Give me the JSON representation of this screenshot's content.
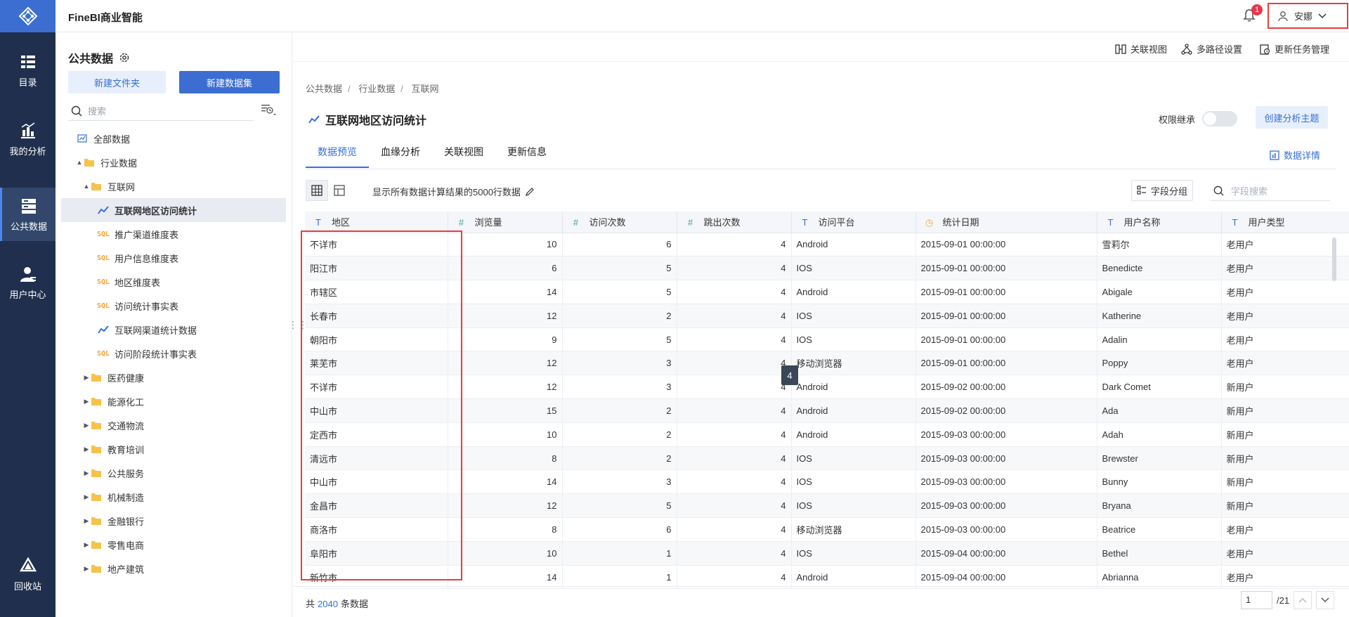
{
  "app": {
    "brand": "FineBI商业智能"
  },
  "nav": {
    "items": [
      {
        "label": "目录",
        "icon": "catalog-icon"
      },
      {
        "label": "我的分析",
        "icon": "analysis-icon"
      },
      {
        "label": "公共数据",
        "icon": "public-data-icon"
      },
      {
        "label": "用户中心",
        "icon": "user-center-icon"
      },
      {
        "label": "回收站",
        "icon": "recycle-icon"
      }
    ]
  },
  "header": {
    "notification_count": "1",
    "user_name": "安娜"
  },
  "sidebar": {
    "title": "公共数据",
    "new_folder": "新建文件夹",
    "new_dataset": "新建数据集",
    "search_placeholder": "搜索",
    "tree": [
      {
        "label": "全部数据",
        "type": "all",
        "level": 0,
        "caret": ""
      },
      {
        "label": "行业数据",
        "type": "folder",
        "level": 1,
        "caret": "▲"
      },
      {
        "label": "互联网",
        "type": "folder",
        "level": 2,
        "caret": "▲"
      },
      {
        "label": "互联网地区访问统计",
        "type": "analysis",
        "level": 3,
        "caret": "",
        "selected": true
      },
      {
        "label": "推广渠道维度表",
        "type": "sql",
        "level": 3,
        "caret": ""
      },
      {
        "label": "用户信息维度表",
        "type": "sql",
        "level": 3,
        "caret": ""
      },
      {
        "label": "地区维度表",
        "type": "sql",
        "level": 3,
        "caret": ""
      },
      {
        "label": "访问统计事实表",
        "type": "sql",
        "level": 3,
        "caret": ""
      },
      {
        "label": "互联网渠道统计数据",
        "type": "analysis",
        "level": 3,
        "caret": ""
      },
      {
        "label": "访问阶段统计事实表",
        "type": "sql",
        "level": 3,
        "caret": ""
      },
      {
        "label": "医药健康",
        "type": "folder",
        "level": 2,
        "caret": "▶"
      },
      {
        "label": "能源化工",
        "type": "folder",
        "level": 2,
        "caret": "▶"
      },
      {
        "label": "交通物流",
        "type": "folder",
        "level": 2,
        "caret": "▶"
      },
      {
        "label": "教育培训",
        "type": "folder",
        "level": 2,
        "caret": "▶"
      },
      {
        "label": "公共服务",
        "type": "folder",
        "level": 2,
        "caret": "▶"
      },
      {
        "label": "机械制造",
        "type": "folder",
        "level": 2,
        "caret": "▶"
      },
      {
        "label": "金融银行",
        "type": "folder",
        "level": 2,
        "caret": "▶"
      },
      {
        "label": "零售电商",
        "type": "folder",
        "level": 2,
        "caret": "▶"
      },
      {
        "label": "地产建筑",
        "type": "folder",
        "level": 2,
        "caret": "▶"
      }
    ]
  },
  "toolbar": {
    "relation_view": "关联视图",
    "multipath": "多路径设置",
    "update_tasks": "更新任务管理"
  },
  "breadcrumb": [
    "公共数据",
    "行业数据",
    "互联网"
  ],
  "page": {
    "title": "互联网地区访问统计",
    "permission_label": "权限继承",
    "create_theme": "创建分析主题",
    "data_detail": "数据详情"
  },
  "tabs": [
    "数据预览",
    "血缘分析",
    "关联视图",
    "更新信息"
  ],
  "preview": {
    "row_info": "显示所有数据计算结果的5000行数据",
    "group_btn": "字段分组",
    "field_search_placeholder": "字段搜索",
    "tooltip": "4"
  },
  "table": {
    "columns": [
      {
        "label": "地区",
        "type": "text"
      },
      {
        "label": "浏览量",
        "type": "number"
      },
      {
        "label": "访问次数",
        "type": "number"
      },
      {
        "label": "跳出次数",
        "type": "number"
      },
      {
        "label": "访问平台",
        "type": "text"
      },
      {
        "label": "统计日期",
        "type": "date"
      },
      {
        "label": "用户名称",
        "type": "text"
      },
      {
        "label": "用户类型",
        "type": "text"
      }
    ],
    "rows": [
      [
        "不详市",
        "10",
        "6",
        "4",
        "Android",
        "2015-09-01 00:00:00",
        "雪莉尔",
        "老用户"
      ],
      [
        "阳江市",
        "6",
        "5",
        "4",
        "IOS",
        "2015-09-01 00:00:00",
        "Benedicte",
        "老用户"
      ],
      [
        "市辖区",
        "14",
        "5",
        "4",
        "Android",
        "2015-09-01 00:00:00",
        "Abigale",
        "老用户"
      ],
      [
        "长春市",
        "12",
        "2",
        "4",
        "IOS",
        "2015-09-01 00:00:00",
        "Katherine",
        "老用户"
      ],
      [
        "朝阳市",
        "9",
        "5",
        "4",
        "IOS",
        "2015-09-01 00:00:00",
        "Adalin",
        "老用户"
      ],
      [
        "莱芜市",
        "12",
        "3",
        "4",
        "移动浏览器",
        "2015-09-01 00:00:00",
        "Poppy",
        "老用户"
      ],
      [
        "不详市",
        "12",
        "3",
        "4",
        "Android",
        "2015-09-02 00:00:00",
        "Dark Comet",
        "新用户"
      ],
      [
        "中山市",
        "15",
        "2",
        "4",
        "Android",
        "2015-09-02 00:00:00",
        "Ada",
        "新用户"
      ],
      [
        "定西市",
        "10",
        "2",
        "4",
        "Android",
        "2015-09-03 00:00:00",
        "Adah",
        "新用户"
      ],
      [
        "清远市",
        "8",
        "2",
        "4",
        "IOS",
        "2015-09-03 00:00:00",
        "Brewster",
        "新用户"
      ],
      [
        "中山市",
        "14",
        "3",
        "4",
        "IOS",
        "2015-09-03 00:00:00",
        "Bunny",
        "新用户"
      ],
      [
        "金昌市",
        "12",
        "5",
        "4",
        "IOS",
        "2015-09-03 00:00:00",
        "Bryana",
        "新用户"
      ],
      [
        "商洛市",
        "8",
        "6",
        "4",
        "移动浏览器",
        "2015-09-03 00:00:00",
        "Beatrice",
        "老用户"
      ],
      [
        "阜阳市",
        "10",
        "1",
        "4",
        "IOS",
        "2015-09-04 00:00:00",
        "Bethel",
        "老用户"
      ],
      [
        "新竹市",
        "14",
        "1",
        "4",
        "Android",
        "2015-09-04 00:00:00",
        "Abrianna",
        "老用户"
      ]
    ]
  },
  "footer": {
    "total_prefix": "共",
    "total_count": "2040",
    "total_suffix": "条数据",
    "page": "1",
    "pages": "/21"
  },
  "colors": {
    "accent": "#3c6ed2",
    "nav_bg": "#1f2f4d",
    "highlight": "#e53e3e"
  }
}
